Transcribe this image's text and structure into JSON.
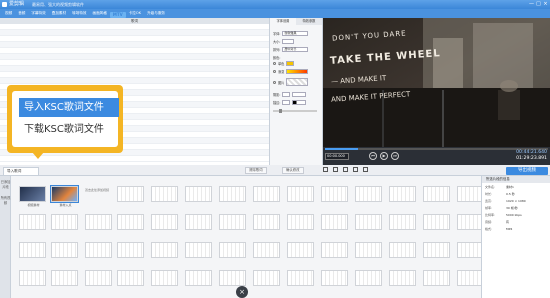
{
  "app": {
    "name": "爱剪辑",
    "title": "最易用、强大的视频剪辑软件"
  },
  "window_buttons": [
    "—",
    "□",
    "×"
  ],
  "tabs": [
    "视频",
    "音频",
    "字幕特效",
    "叠加素材",
    "转场特效",
    "画面风格",
    "MTV",
    "卡拉OK",
    "升级与服务"
  ],
  "lyric_panel": {
    "header": "歌词"
  },
  "settings": {
    "tabs": [
      "字体设置",
      "特效参数"
    ],
    "font_label": "字体:",
    "font_value": "微软雅黑",
    "size_label": "大小:",
    "align_label": "排列:",
    "align_value": "居中对齐",
    "color_label": "颜色:",
    "fill_label": "单色",
    "gradient_label": "渐变",
    "texture_label": "图片",
    "shadow_label": "阴影:",
    "stroke_label": "描边:"
  },
  "preview": {
    "lines": [
      "DON'T YOU DARE",
      "TAKE THE WHEEL",
      "— AND MAKE IT",
      "AND MAKE IT PERFECT"
    ]
  },
  "controls": {
    "time_input": "00:00.000",
    "progress": 0.15,
    "current_time": "00:44:21.640",
    "total_time": "01:29:23.891"
  },
  "popup": {
    "item1": "导入KSC歌词文件",
    "item2": "下载KSC歌词文件"
  },
  "toolbar": {
    "import_label": "导入歌词",
    "clear_label": "清除歌词",
    "confirm_label": "确认修改",
    "export_label": "导出视频"
  },
  "rail": [
    "已添加片段",
    "所有视频"
  ],
  "timeline": {
    "clip1": "视频素材",
    "clip2": "素材入点",
    "placeholder": "双击此处添加视频"
  },
  "properties": {
    "header": "所选片段的信息",
    "rows": [
      {
        "k": "文件名:",
        "v": "素材1"
      },
      {
        "k": "时长:",
        "v": "0.5 秒"
      },
      {
        "k": "宽高:",
        "v": "1920 × 1080"
      },
      {
        "k": "帧率:",
        "v": "30 帧/秒"
      },
      {
        "k": "比特率:",
        "v": "5000 kbps"
      },
      {
        "k": "音频:",
        "v": "有"
      },
      {
        "k": "格式:",
        "v": "MP4"
      }
    ]
  },
  "close_badge": "×"
}
